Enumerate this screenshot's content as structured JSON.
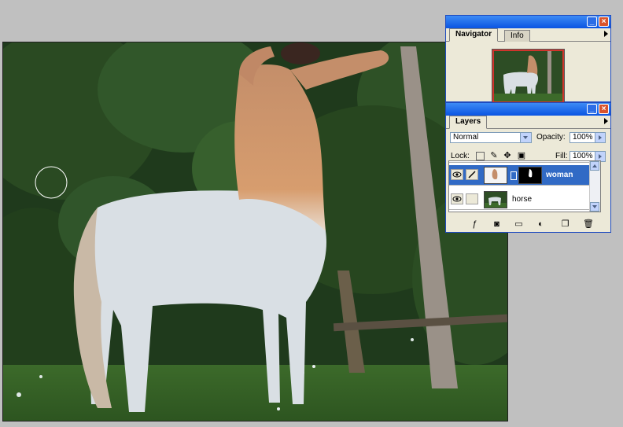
{
  "navigator_panel": {
    "tabs": [
      {
        "label": "Navigator",
        "active": true
      },
      {
        "label": "Info",
        "active": false
      }
    ],
    "view_box_color": "#d0342c"
  },
  "layers_panel": {
    "tab_label": "Layers",
    "blend_mode": "Normal",
    "opacity_label": "Opacity:",
    "opacity_value": "100%",
    "lock_label": "Lock:",
    "fill_label": "Fill:",
    "fill_value": "100%",
    "layers": [
      {
        "name": "woman",
        "selected": true,
        "has_mask": true
      },
      {
        "name": "horse",
        "selected": false,
        "has_mask": false
      }
    ],
    "footer_icons": [
      "layer-style-icon",
      "add-mask-icon",
      "new-group-icon",
      "adjustment-layer-icon",
      "new-layer-icon",
      "trash-icon"
    ]
  },
  "colors": {
    "titlebar": "#0a54e2",
    "selection": "#316ac5",
    "panel_bg": "#ece9d8"
  }
}
